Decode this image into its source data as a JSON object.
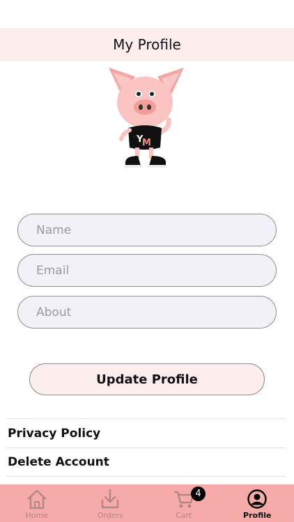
{
  "header": {
    "title": "My Profile"
  },
  "form": {
    "name_placeholder": "Name",
    "email_placeholder": "Email",
    "about_placeholder": "About",
    "update_label": "Update Profile"
  },
  "menu": [
    {
      "label": "Privacy Policy"
    },
    {
      "label": "Delete Account"
    }
  ],
  "tabbar": {
    "tabs": [
      {
        "label": "Home",
        "icon": "home-icon",
        "active": false
      },
      {
        "label": "Orders",
        "icon": "orders-icon",
        "active": false
      },
      {
        "label": "Cart",
        "icon": "cart-icon",
        "active": false,
        "badge": "4"
      },
      {
        "label": "Profile",
        "icon": "profile-icon",
        "active": true
      }
    ]
  },
  "colors": {
    "header_bg": "#fdeeed",
    "tabbar_bg": "#f6aba8",
    "field_bg": "#f2f1f7",
    "pig_pink": "#f9c4c2"
  }
}
